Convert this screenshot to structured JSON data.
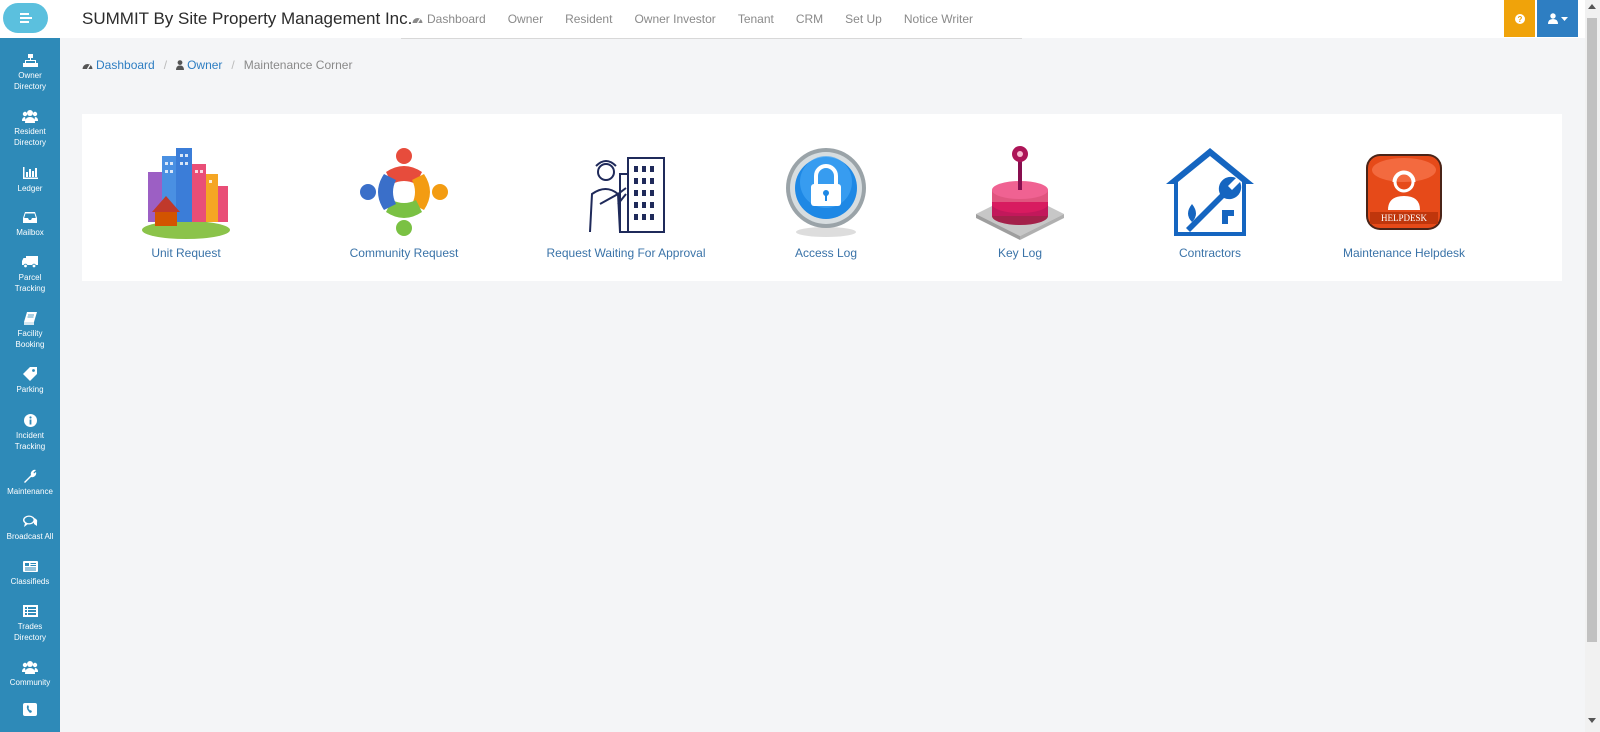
{
  "header": {
    "brand": "SUMMIT By Site Property Management Inc.",
    "nav": [
      {
        "label": "Dashboard",
        "icon": "dashboard-icon"
      },
      {
        "label": "Owner"
      },
      {
        "label": "Resident"
      },
      {
        "label": "Owner Investor"
      },
      {
        "label": "Tenant"
      },
      {
        "label": "CRM"
      },
      {
        "label": "Set Up"
      },
      {
        "label": "Notice Writer"
      }
    ],
    "help_icon": "question-icon",
    "user_icon": "user-icon",
    "help_color": "#f0a30a",
    "user_color": "#2e7ec2"
  },
  "sidebar": {
    "color": "#2e8ab8",
    "items": [
      {
        "label": "Owner Directory",
        "icon": "sitemap-icon"
      },
      {
        "label": "Resident Directory",
        "icon": "users-icon"
      },
      {
        "label": "Ledger",
        "icon": "bar-chart-icon"
      },
      {
        "label": "Mailbox",
        "icon": "inbox-icon"
      },
      {
        "label": "Parcel Tracking",
        "icon": "truck-icon"
      },
      {
        "label": "Facility Booking",
        "icon": "book-icon"
      },
      {
        "label": "Parking",
        "icon": "tag-icon"
      },
      {
        "label": "Incident Tracking",
        "icon": "info-icon"
      },
      {
        "label": "Maintenance",
        "icon": "wrench-icon"
      },
      {
        "label": "Broadcast All",
        "icon": "comments-icon"
      },
      {
        "label": "Classifieds",
        "icon": "newspaper-icon"
      },
      {
        "label": "Trades Directory",
        "icon": "list-icon"
      },
      {
        "label": "Community",
        "icon": "group-icon"
      },
      {
        "label": "",
        "icon": "phone-icon"
      }
    ]
  },
  "breadcrumb": {
    "dashboard": "Dashboard",
    "owner": "Owner",
    "current": "Maintenance Corner"
  },
  "tiles": [
    {
      "label": "Unit Request",
      "icon": "city-buildings-icon"
    },
    {
      "label": "Community Request",
      "icon": "community-people-icon"
    },
    {
      "label": "Request Waiting For Approval",
      "icon": "worker-building-icon"
    },
    {
      "label": "Access Log",
      "icon": "padlock-icon"
    },
    {
      "label": "Key Log",
      "icon": "key-database-icon"
    },
    {
      "label": "Contractors",
      "icon": "house-wrench-icon"
    },
    {
      "label": "Maintenance Helpdesk",
      "icon": "helpdesk-icon",
      "badge_text": "HELPDESK"
    }
  ]
}
